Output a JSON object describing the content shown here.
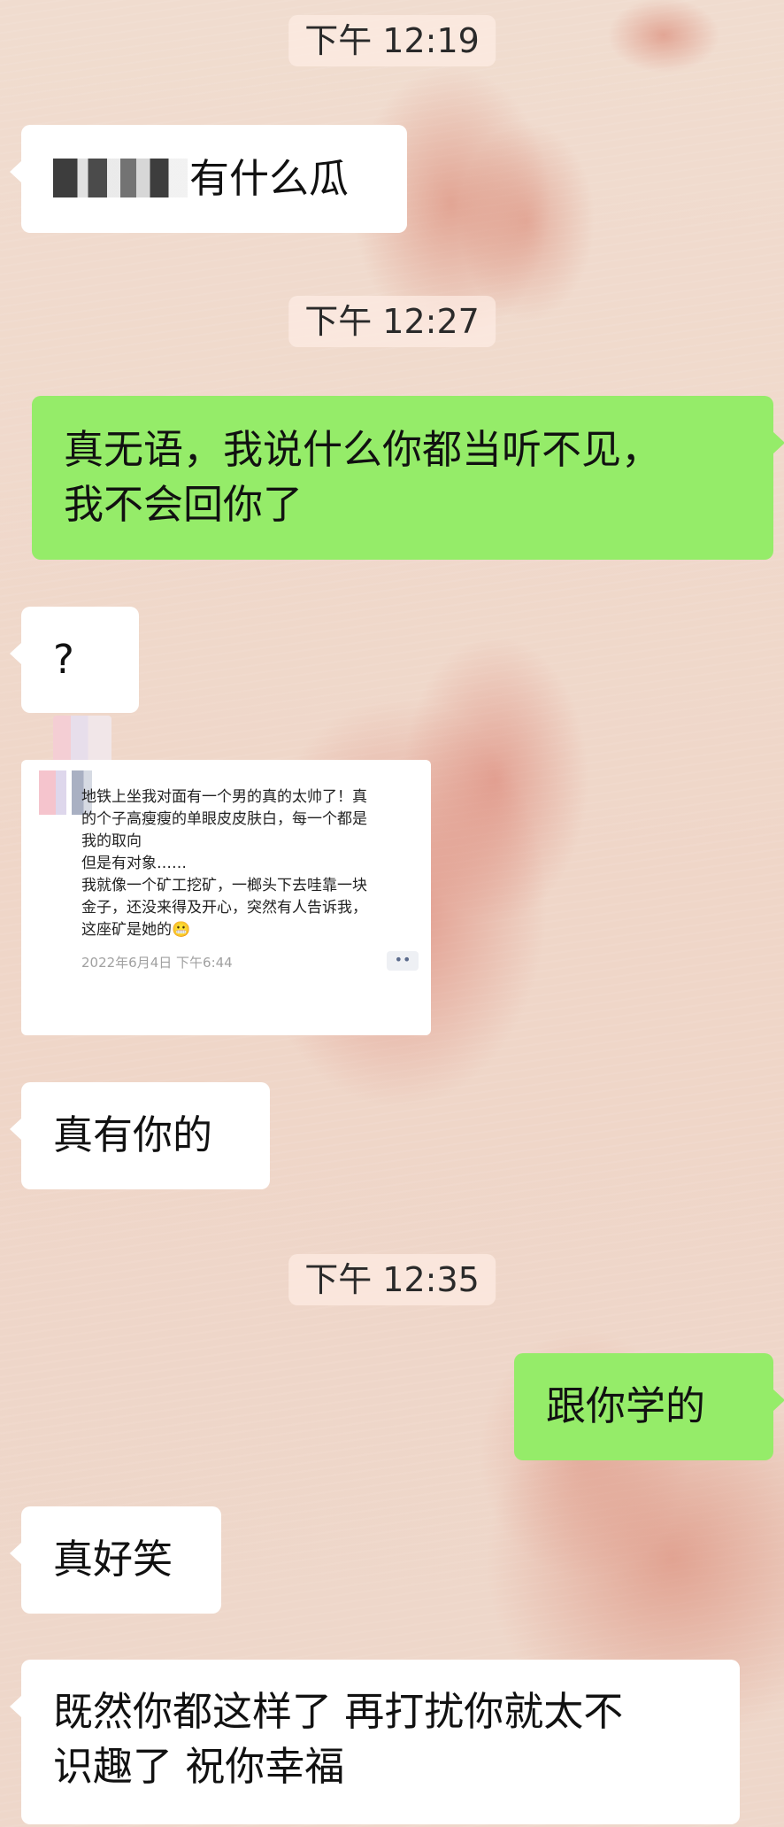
{
  "chat": {
    "messages": [
      {
        "type": "time",
        "text": "下午 12:19"
      },
      {
        "type": "text",
        "side": "left",
        "text": "有什么瓜",
        "has_redaction": true
      },
      {
        "type": "time",
        "text": "下午 12:27"
      },
      {
        "type": "text",
        "side": "right",
        "text": "真无语，我说什么你都当听不见，\n我不会回你了"
      },
      {
        "type": "text",
        "side": "left",
        "text": "?"
      },
      {
        "type": "image",
        "side": "left",
        "post": {
          "text": "地铁上坐我对面有一个男的真的太帅了！真\n的个子高瘦瘦的单眼皮皮肤白，每一个都是\n我的取向\n但是有对象……\n我就像一个矿工挖矿，一榔头下去哇靠一块\n金子，还没来得及开心，突然有人告诉我，\n这座矿是她的😬",
          "timestamp": "2022年6月4日 下午6:44",
          "more_glyph": "••"
        }
      },
      {
        "type": "text",
        "side": "left",
        "text": "真有你的"
      },
      {
        "type": "time",
        "text": "下午 12:35"
      },
      {
        "type": "text",
        "side": "right",
        "text": "跟你学的"
      },
      {
        "type": "text",
        "side": "left",
        "text": "真好笑"
      },
      {
        "type": "text",
        "side": "left",
        "text": "既然你都这样了 再打扰你就太不\n识趣了 祝你幸福"
      }
    ]
  },
  "colors": {
    "bubble_left": "#ffffff",
    "bubble_right": "#95ec69",
    "background": "#efd9cc"
  }
}
